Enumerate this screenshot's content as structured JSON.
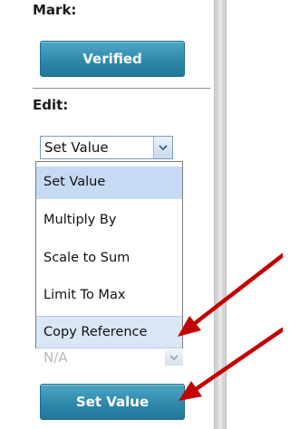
{
  "mark": {
    "label": "Mark:",
    "button_label": "Verified"
  },
  "edit": {
    "label": "Edit:",
    "select_value": "Set Value",
    "options": [
      "Set Value",
      "Multiply By",
      "Scale to Sum",
      "Limit To Max",
      "Copy Reference"
    ],
    "selected_option": "Set Value",
    "hovered_option": "Copy Reference",
    "secondary_select_value": "N/A",
    "apply_button_label": "Set Value"
  },
  "icons": {
    "dropdown_arrow": "chevron-down-icon",
    "annotation_arrows": "red-arrow-icon"
  },
  "colors": {
    "button_blue": "#2e89aa",
    "selected_option_bg": "#c6daf3",
    "hover_option_bg": "#d8e6f6",
    "annotation_red": "#c40000"
  }
}
